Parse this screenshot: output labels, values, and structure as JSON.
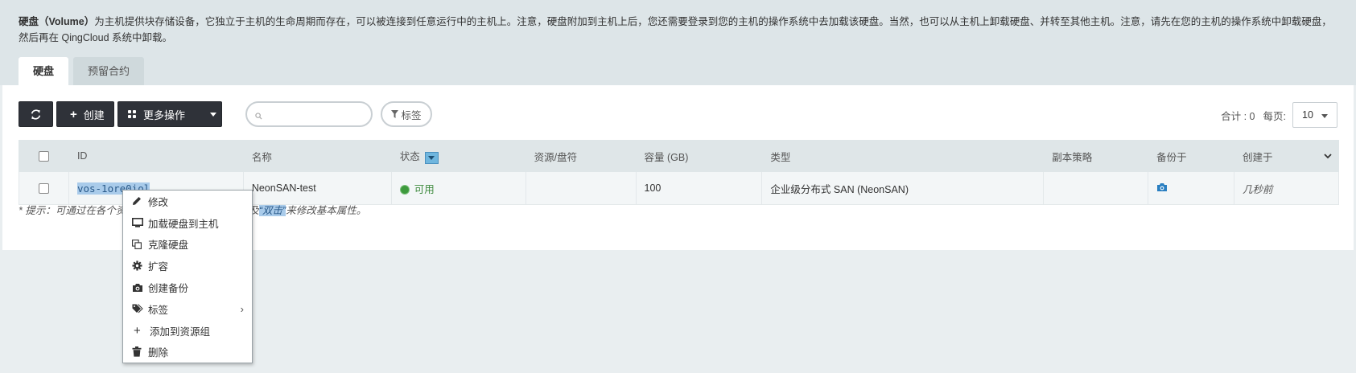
{
  "intro": {
    "title": "硬盘（Volume）",
    "text": "为主机提供块存储设备，它独立于主机的生命周期而存在，可以被连接到任意运行中的主机上。注意，硬盘附加到主机上后，您还需要登录到您的主机的操作系统中去加载该硬盘。当然，也可以从主机上卸载硬盘、并转至其他主机。注意，请先在您的主机的操作系统中卸载硬盘，然后再在 QingCloud 系统中卸载。"
  },
  "tabs": [
    {
      "label": "硬盘",
      "active": true
    },
    {
      "label": "预留合约",
      "active": false
    }
  ],
  "toolbar": {
    "refresh_icon": "refresh-icon",
    "create_label": "创建",
    "more_label": "更多操作",
    "search_placeholder": "",
    "tag_label": "标签",
    "total_label": "合计 : 0",
    "per_page_label": "每页:",
    "per_page_value": "10"
  },
  "table": {
    "headers": [
      "ID",
      "名称",
      "状态",
      "资源/盘符",
      "容量 (GB)",
      "类型",
      "副本策略",
      "备份于",
      "创建于"
    ],
    "rows": [
      {
        "id": "vos-1ore0iol",
        "name": "NeonSAN-test",
        "status": "可用",
        "resource": "",
        "capacity": "100",
        "type": "企业级分布式 SAN (NeonSAN)",
        "replica": "",
        "backup_icon": "camera-icon",
        "created": "几秒前"
      }
    ]
  },
  "hint": {
    "prefix": "* 提示：可通过在各个资",
    "suffix": "，以及",
    "highlight": "“双击”",
    "end": "来修改基本属性。"
  },
  "context_menu": {
    "items": [
      {
        "label": "修改",
        "icon": "pencil-icon"
      },
      {
        "label": "加载硬盘到主机",
        "icon": "monitor-icon"
      },
      {
        "label": "克隆硬盘",
        "icon": "clone-icon"
      },
      {
        "label": "扩容",
        "icon": "gear-icon"
      },
      {
        "label": "创建备份",
        "icon": "camera-icon"
      },
      {
        "label": "标签",
        "icon": "tags-icon",
        "submenu": true
      },
      {
        "label": "添加到资源组",
        "icon": "plus-icon"
      },
      {
        "label": "删除",
        "icon": "trash-icon"
      }
    ]
  },
  "colors": {
    "toolbar_button": "#2f3239",
    "status_green": "#3d9a3d",
    "selection": "#a9cbea",
    "camera_blue": "#2a7fc1"
  }
}
